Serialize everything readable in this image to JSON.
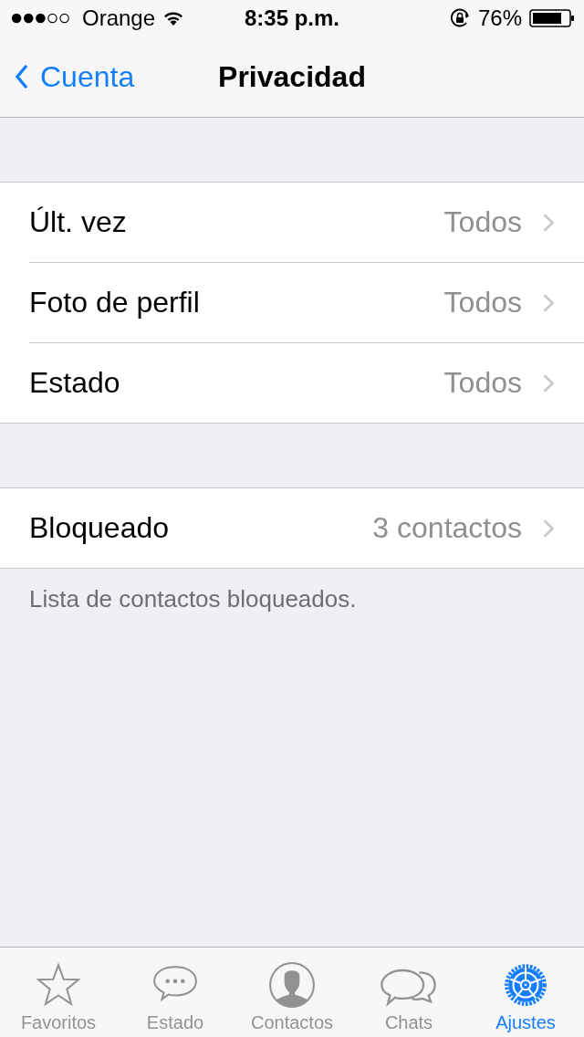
{
  "status_bar": {
    "carrier": "Orange",
    "time": "8:35 p.m.",
    "battery": "76%"
  },
  "nav_bar": {
    "back": "Cuenta",
    "title": "Privacidad"
  },
  "groups": [
    {
      "rows": [
        {
          "label": "Últ. vez",
          "value": "Todos"
        },
        {
          "label": "Foto de perfil",
          "value": "Todos"
        },
        {
          "label": "Estado",
          "value": "Todos"
        }
      ]
    },
    {
      "rows": [
        {
          "label": "Bloqueado",
          "value": "3 contactos"
        }
      ],
      "footer": "Lista de contactos bloqueados."
    }
  ],
  "tab_bar": [
    {
      "kind": "star",
      "label": "Favoritos",
      "selected": false
    },
    {
      "kind": "bubble",
      "label": "Estado",
      "selected": false
    },
    {
      "kind": "person",
      "label": "Contactos",
      "selected": false
    },
    {
      "kind": "chats",
      "label": "Chats",
      "selected": false
    },
    {
      "kind": "gear",
      "label": "Ajustes",
      "selected": true
    }
  ]
}
